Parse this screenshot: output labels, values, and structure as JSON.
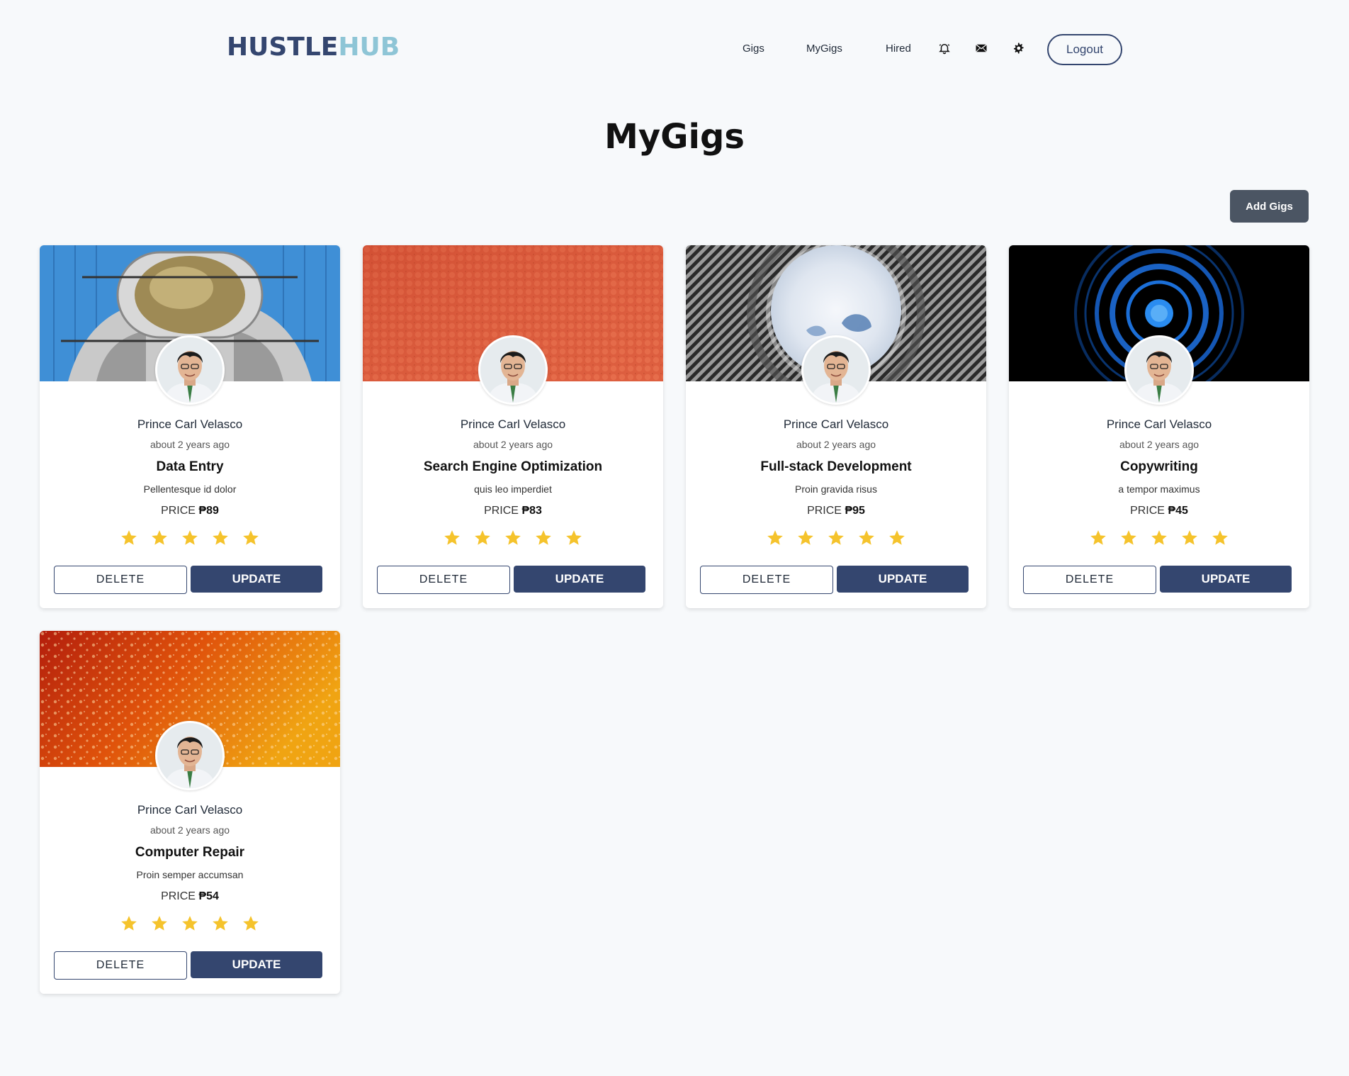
{
  "nav": {
    "logo_part1": "HUSTLE",
    "logo_part2": "HUB",
    "links": [
      "Gigs",
      "MyGigs",
      "Hired"
    ],
    "icons": [
      "bell-icon",
      "mail-icon",
      "gear-icon"
    ],
    "logout_label": "Logout"
  },
  "page": {
    "title": "MyGigs",
    "add_button": "Add Gigs"
  },
  "colors": {
    "brand_dark": "#34466f",
    "brand_light": "#8ec5d6",
    "star": "#f5c32c",
    "add_button": "#4b5563"
  },
  "gigs": [
    {
      "name": "Prince Carl Velasco",
      "time": "about 2 years ago",
      "title": "Data Entry",
      "description": "Pellentesque id dolor",
      "price_label": "PRICE",
      "price": "₱89",
      "rating": 5,
      "cover": "astronaut-mural",
      "delete_label": "DELETE",
      "update_label": "UPDATE"
    },
    {
      "name": "Prince Carl Velasco",
      "time": "about 2 years ago",
      "title": "Search Engine Optimization",
      "description": "quis leo imperdiet",
      "price_label": "PRICE",
      "price": "₱83",
      "rating": 5,
      "cover": "orange-leather",
      "delete_label": "DELETE",
      "update_label": "UPDATE"
    },
    {
      "name": "Prince Carl Velasco",
      "time": "about 2 years ago",
      "title": "Full-stack Development",
      "description": "Proin gravida risus",
      "price_label": "PRICE",
      "price": "₱95",
      "rating": 5,
      "cover": "sky-oculus",
      "delete_label": "DELETE",
      "update_label": "UPDATE"
    },
    {
      "name": "Prince Carl Velasco",
      "time": "about 2 years ago",
      "title": "Copywriting",
      "description": "a tempor maximus",
      "price_label": "PRICE",
      "price": "₱45",
      "rating": 5,
      "cover": "blue-rings",
      "delete_label": "DELETE",
      "update_label": "UPDATE"
    },
    {
      "name": "Prince Carl Velasco",
      "time": "about 2 years ago",
      "title": "Computer Repair",
      "description": "Proin semper accumsan",
      "price_label": "PRICE",
      "price": "₱54",
      "rating": 5,
      "cover": "water-droplets",
      "delete_label": "DELETE",
      "update_label": "UPDATE"
    }
  ]
}
